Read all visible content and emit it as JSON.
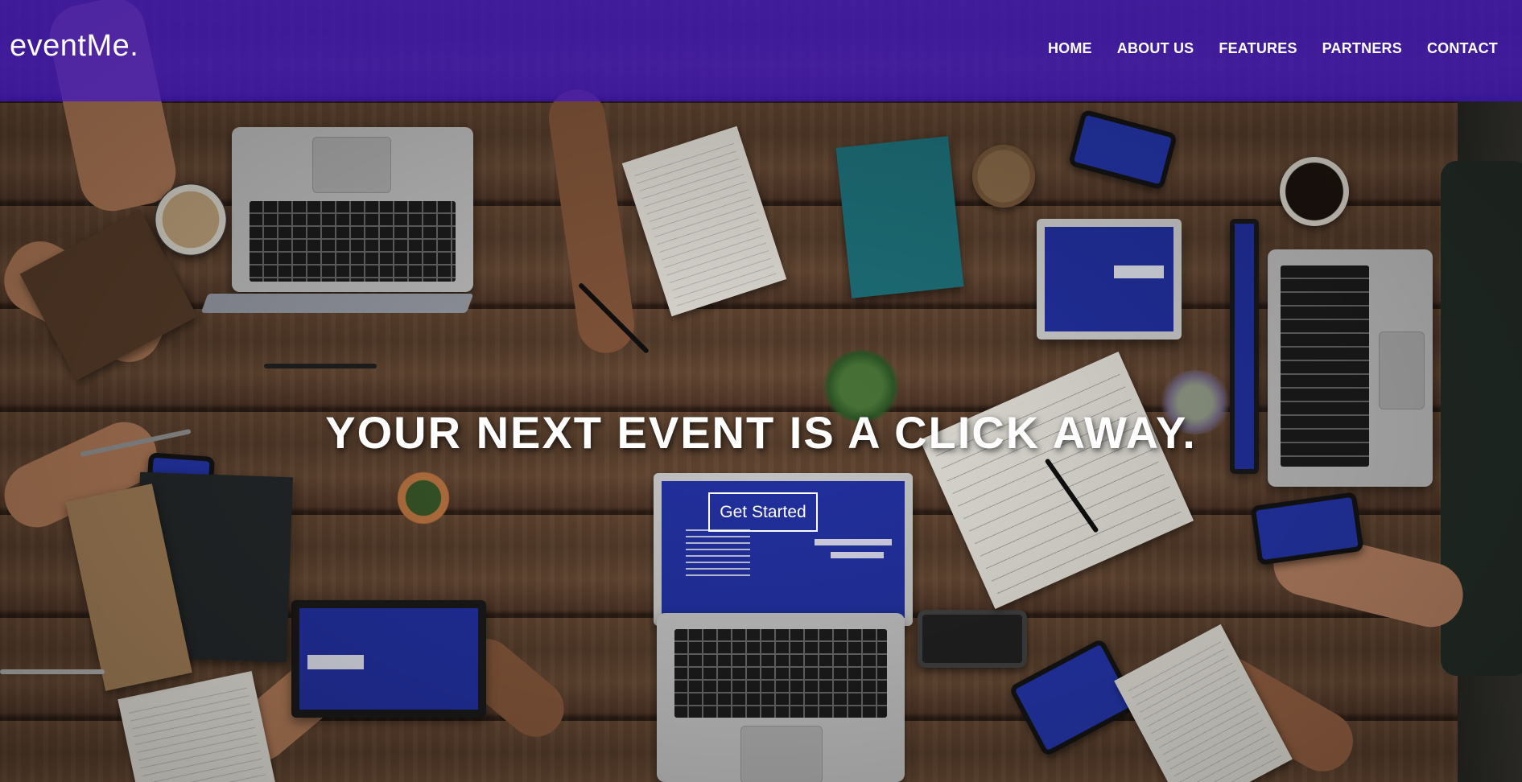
{
  "brand": {
    "name": "eventMe."
  },
  "nav": {
    "items": [
      {
        "label": "HOME"
      },
      {
        "label": "ABOUT US"
      },
      {
        "label": "FEATURES"
      },
      {
        "label": "PARTNERS"
      },
      {
        "label": "CONTACT"
      }
    ]
  },
  "hero": {
    "headline": "YOUR NEXT EVENT IS A CLICK AWAY.",
    "cta_label": "Get Started"
  },
  "colors": {
    "navbar_overlay": "#3f14c8",
    "text": "#ffffff"
  }
}
